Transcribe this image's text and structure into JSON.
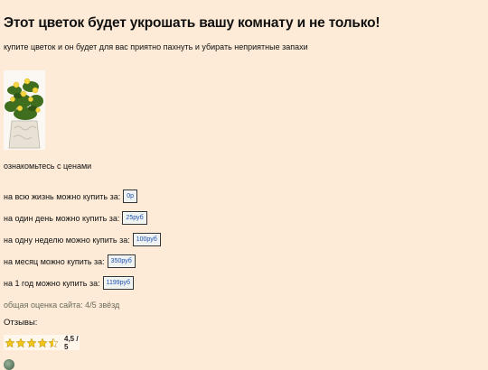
{
  "heading": "Этот цветок будет укрошать вашу комнату и не только!",
  "subtitle": "купите цветок и он будет для вас приятно пахнуть и убирать неприятные запахи",
  "intro": "ознакомьтесь с ценами",
  "prices": [
    {
      "label": "на всю жизнь можно купить за:",
      "value": "0р"
    },
    {
      "label": "на один день можно купить за:",
      "value": "25руб"
    },
    {
      "label": "на одну неделю можно купить за:",
      "value": "100руб"
    },
    {
      "label": "на месяц можно купить за:",
      "value": "350руб"
    },
    {
      "label": "на 1 год можно купить за:",
      "value": "1199руб"
    }
  ],
  "site_rating": "общая оценка сайта: 4/5 звёзд",
  "reviews_label": "Отзывы:",
  "rating": {
    "score_text": "4,5 / 5",
    "value": 4.5,
    "max": 5
  },
  "colors": {
    "background": "#fdebd7",
    "star": "#f2c51a",
    "link": "#1f4fb0"
  }
}
